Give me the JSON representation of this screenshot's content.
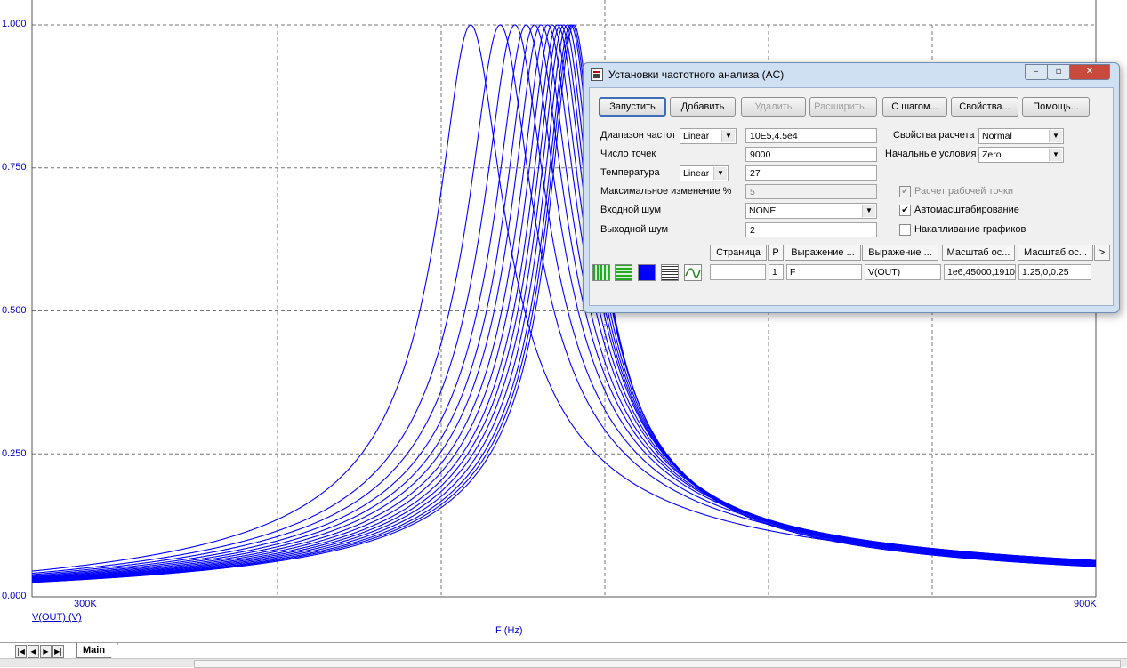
{
  "chart_data": {
    "type": "line",
    "xlabel": "F (Hz)",
    "ylabel": "V(OUT) (V)",
    "xlim": [
      250000,
      900000
    ],
    "ylim": [
      0,
      1.0
    ],
    "x_tick_labels": [
      "300K",
      "900K"
    ],
    "y_tick_labels": [
      "0.000",
      "0.250",
      "0.500",
      "0.750",
      "1.000"
    ],
    "y_ticks": [
      0,
      0.25,
      0.5,
      0.75,
      1.0
    ],
    "grid": true,
    "line_color": "#0000ff",
    "peak_frequencies_hz": [
      518000,
      536000,
      545000,
      552000,
      557000,
      561000,
      565000,
      568000,
      571000,
      573000,
      575000,
      577000,
      579000,
      580000,
      581000
    ],
    "peak_value": 1.0,
    "series_shape": "resonance"
  },
  "sheet_tabs": {
    "nav_buttons": [
      "|◀",
      "◀",
      "▶",
      "▶|"
    ],
    "active_tab": "Main"
  },
  "dialog": {
    "title": "Установки частотного анализа (AC)",
    "window_buttons": {
      "minimize": "–",
      "maximize": "▫",
      "close": "✕"
    },
    "buttons": {
      "run": "Запустить",
      "add": "Добавить",
      "delete": "Удалить",
      "expand": "Расширить...",
      "stepping": "С шагом...",
      "properties": "Свойства...",
      "help": "Помощь..."
    },
    "freq_range_label": "Диапазон частот",
    "freq_range_mode": "Linear",
    "freq_range_value": "10E5,4.5e4",
    "points_label": "Число точек",
    "points_value": "9000",
    "temperature_label": "Температура",
    "temperature_mode": "Linear",
    "temperature_value": "27",
    "max_change_label": "Максимальное изменение %",
    "max_change_value": "5",
    "input_noise_label": "Входной шум",
    "input_noise_value": "NONE",
    "output_noise_label": "Выходной шум",
    "output_noise_value": "2",
    "calc_props_label": "Свойства расчета",
    "calc_props_value": "Normal",
    "initial_cond_label": "Начальные условия",
    "initial_cond_value": "Zero",
    "op_point_label": "Расчет рабочей точки",
    "op_point_checked": true,
    "autoscale_label": "Автомасштабирование",
    "autoscale_checked": true,
    "accumulate_label": "Накапливание графиков",
    "accumulate_checked": false,
    "check_mark": "✔",
    "grid_headers": [
      "Страница",
      "P",
      "Выражение ...",
      "Выражение ...",
      "Масштаб ос...",
      "Масштаб ос...",
      ">"
    ],
    "grid_row": [
      "",
      "1",
      "F",
      "V(OUT)",
      "1e6,45000,1910",
      "1.25,0,0.25"
    ]
  }
}
